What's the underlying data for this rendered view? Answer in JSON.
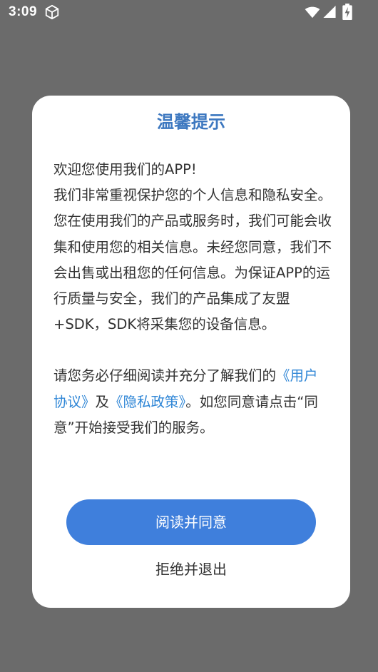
{
  "status_bar": {
    "time": "3:09",
    "icons": [
      "cube-icon",
      "wifi-icon",
      "signal-icon",
      "battery-charging-icon"
    ]
  },
  "dialog": {
    "title": "温馨提示",
    "para1_line1": "欢迎您使用我们的APP!",
    "para1_rest": "我们非常重视保护您的个人信息和隐私安全。您在使用我们的产品或服务时，我们可能会收集和使用您的相关信息。未经您同意，我们不会出售或出租您的任何信息。为保证APP的运行质量与安全，我们的产品集成了友盟+SDK，SDK将采集您的设备信息。",
    "para2_prefix": "请您务必仔细阅读并充分了解我们的",
    "user_agreement_link": "《用户协议》",
    "conjunction": "及",
    "privacy_policy_link": "《隐私政策》",
    "para2_suffix": "。如您同意请点击“同意”开始接受我们的服务。",
    "agree_button": "阅读并同意",
    "reject_button": "拒绝并退出"
  },
  "colors": {
    "overlay": "#6b6b6b",
    "title": "#3d78c0",
    "link": "#2f86d6",
    "primary_button": "#3f7fdc",
    "text": "#333333"
  }
}
